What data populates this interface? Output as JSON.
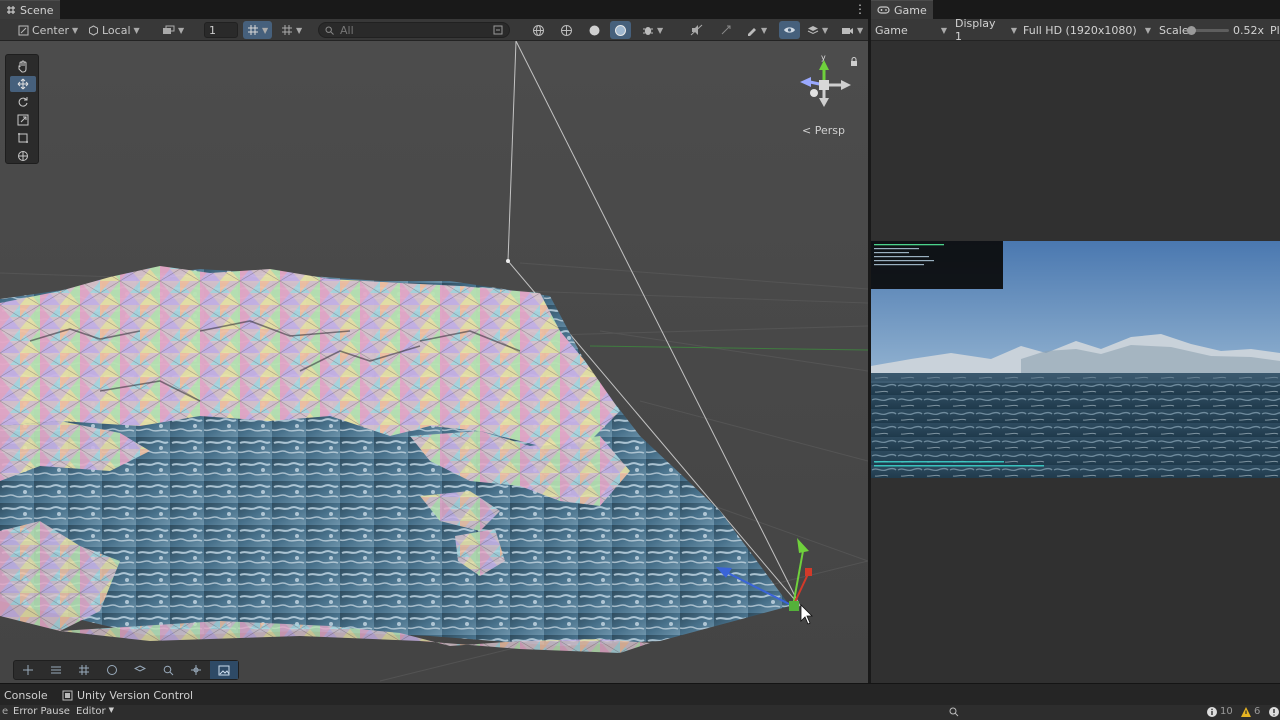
{
  "scene_tab": {
    "label": "Scene",
    "icon": "hash-icon"
  },
  "game_tab": {
    "label": "Game",
    "icon": "gamepad-icon"
  },
  "scene_toolbar": {
    "pivot_label": "Center",
    "space_label": "Local",
    "grid_value": "1",
    "search_placeholder": "All"
  },
  "scene": {
    "persp_label": "Persp",
    "gizmo_axes": {
      "y": "y"
    }
  },
  "game_toolbar": {
    "mode": "Game",
    "display": "Display 1",
    "resolution": "Full HD (1920x1080)",
    "scale_label": "Scale",
    "scale_value": "0.52x",
    "play_label": "Play",
    "scale_fraction": 0.05
  },
  "bottom_tabs": {
    "console": "Console",
    "version_control": "Unity Version Control"
  },
  "console_bar": {
    "error_pause": "Error Pause",
    "editor": "Editor",
    "info_count": "10",
    "warn_count": "6"
  },
  "colors": {
    "accent": "#46607c",
    "scene_bg": "#474747",
    "panel_bg": "#383838",
    "gizmo_x": "#d23a2a",
    "gizmo_y": "#6fd13c",
    "gizmo_z": "#3a64d8"
  }
}
